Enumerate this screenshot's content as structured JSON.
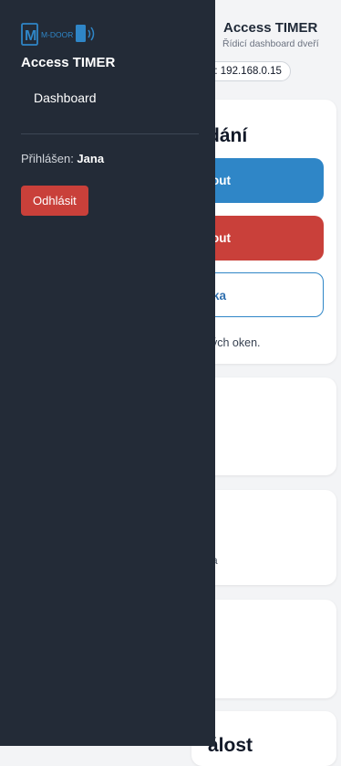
{
  "app": {
    "title": "Access TIMER",
    "subtitle": "Řídicí dashboard dveří",
    "ip_label_partial": "?: 192.168.0.15"
  },
  "commands_card": {
    "title_partial": "dání",
    "open_button_partial": "out",
    "close_button_partial": "out",
    "outline_button_partial": "ka",
    "note_partial": "ých oken."
  },
  "card3": {
    "text_partial": "a"
  },
  "card5": {
    "title_partial": "álost"
  },
  "sidebar": {
    "logo_text": "M-DOOR",
    "logo_letter": "M",
    "title": "Access TIMER",
    "nav": [
      {
        "label": "Dashboard"
      }
    ],
    "logged_in_prefix": "Přihlášen:",
    "user_name": "Jana",
    "logout_label": "Odhlásit"
  },
  "colors": {
    "sidebar_bg": "#232b37",
    "primary_blue": "#2f86c7",
    "danger_red": "#c9403a",
    "page_bg": "#f3f4f6"
  },
  "icons": {
    "logo": "m-door-logo-icon"
  }
}
